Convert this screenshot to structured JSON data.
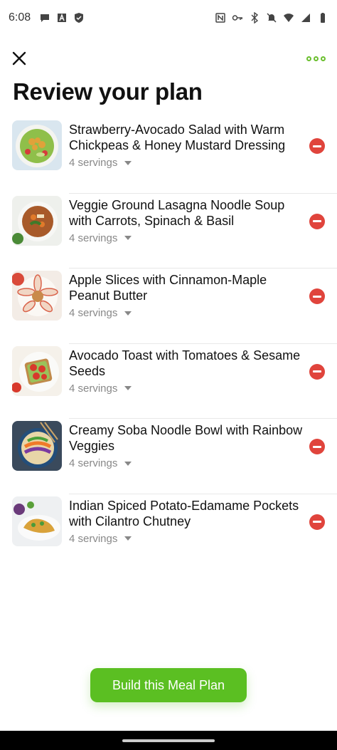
{
  "status_bar": {
    "time": "6:08",
    "left_icons": [
      "chat-bubble-icon",
      "font-icon",
      "shield-check-icon"
    ],
    "right_icons": [
      "nfc-icon",
      "key-icon",
      "bluetooth-icon",
      "mute-icon",
      "wifi-icon",
      "signal-icon",
      "battery-icon"
    ]
  },
  "header": {
    "title": "Review your plan"
  },
  "plan": {
    "items": [
      {
        "title": "Strawberry-Avocado Salad with Warm Chickpeas & Honey Mustard Dressing",
        "servings": "4 servings"
      },
      {
        "title": "Veggie Ground Lasagna Noodle Soup with Carrots, Spinach & Basil",
        "servings": "4 servings"
      },
      {
        "title": "Apple Slices with Cinnamon-Maple Peanut Butter",
        "servings": "4 servings"
      },
      {
        "title": "Avocado Toast with Tomatoes & Sesame Seeds",
        "servings": "4 servings"
      },
      {
        "title": "Creamy Soba Noodle Bowl with Rainbow Veggies",
        "servings": "4 servings"
      },
      {
        "title": "Indian Spiced Potato-Edamame Pockets with Cilantro Chutney",
        "servings": "4 servings"
      }
    ]
  },
  "footer": {
    "build_label": "Build this Meal Plan"
  },
  "colors": {
    "accent": "#5bbf22",
    "remove": "#e0443c"
  }
}
